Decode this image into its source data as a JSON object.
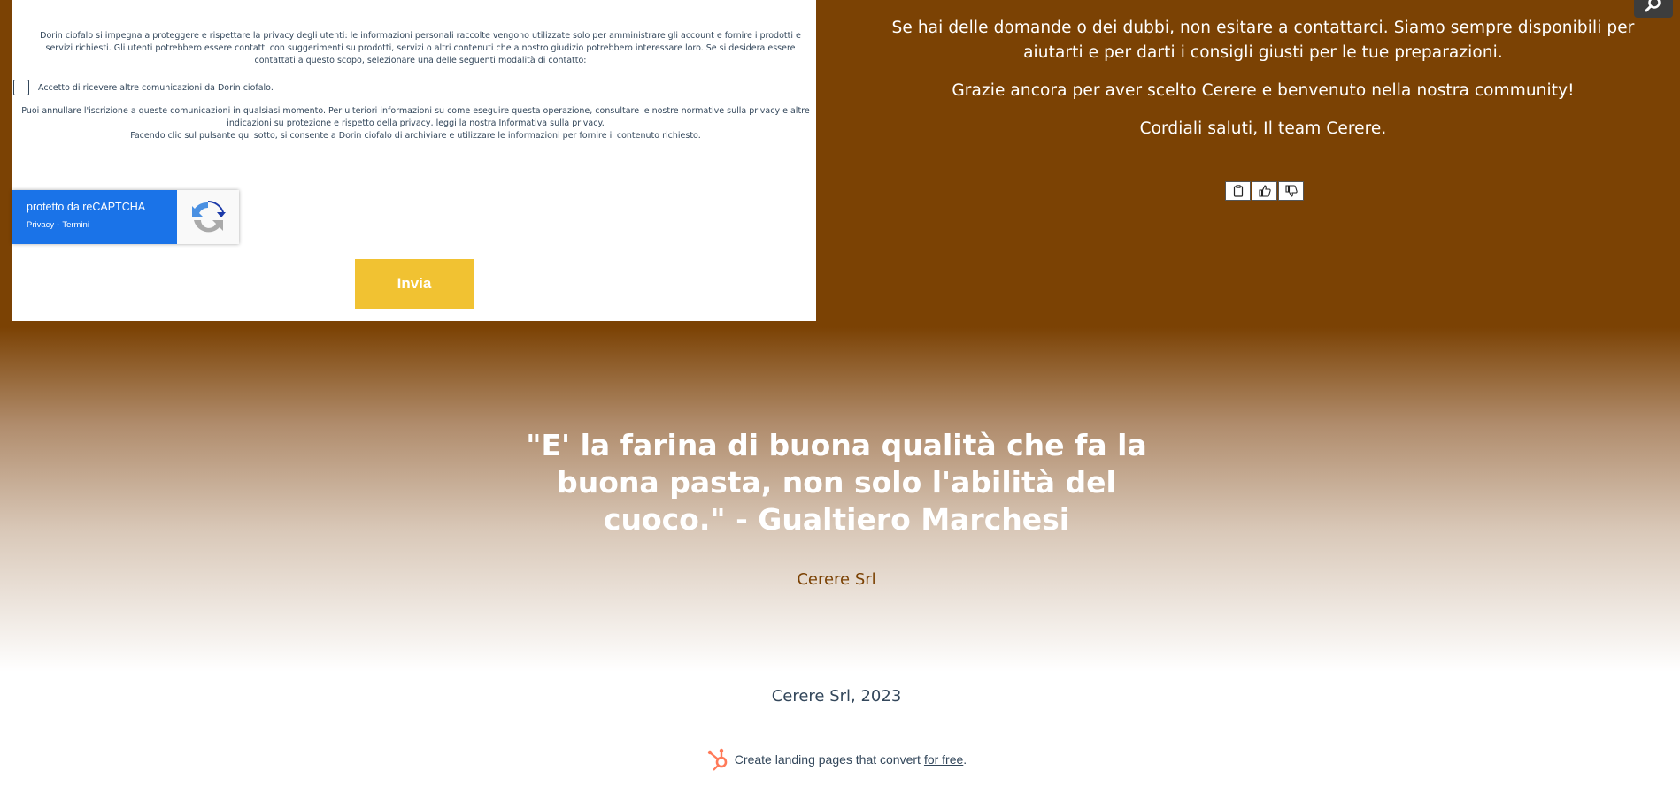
{
  "form": {
    "consent_text": "Dorin ciofalo si impegna a proteggere e rispettare la privacy degli utenti: le informazioni personali raccolte vengono utilizzate solo per amministrare gli account e fornire i prodotti e servizi richiesti. Gli utenti potrebbero essere contatti con suggerimenti su prodotti, servizi o altri contenuti che a nostro giudizio potrebbero interessare loro. Se si desidera essere contattati a questo scopo, selezionare una delle seguenti modalità di contatto:",
    "checkbox_label": "Accetto di ricevere altre comunicazioni da Dorin ciofalo.",
    "unsub_text": "Puoi annullare l'iscrizione a queste comunicazioni in qualsiasi momento. Per ulteriori informazioni su come eseguire questa operazione, consultare le nostre normative sulla privacy e altre indicazioni su protezione e rispetto della privacy, leggi la nostra Informativa sulla privacy.",
    "submit_consent_text": "Facendo clic sul pulsante qui sotto, si consente a Dorin ciofalo di archiviare e utilizzare le informazioni per fornire il contenuto richiesto.",
    "recaptcha": {
      "title": "protetto da reCAPTCHA",
      "privacy": "Privacy",
      "separator": "-",
      "terms": "Termini"
    },
    "submit_label": "Invia"
  },
  "message": {
    "contact_paragraph": "Se hai delle domande o dei dubbi, non esitare a contattarci. Siamo sempre disponibili per aiutarti e per darti i consigli giusti per le tue preparazioni.",
    "thanks_paragraph": "Grazie ancora per aver scelto Cerere e benvenuto nella nostra community!",
    "signoff_paragraph": "Cordiali saluti, Il team Cerere."
  },
  "quote": {
    "text": "\"E' la farina di buona qualità che fa la buona pasta, non solo l'abilità del cuoco.\" - Gualtiero Marchesi",
    "author": "Cerere Srl"
  },
  "footer": {
    "copyright": "Cerere Srl, 2023",
    "hubspot_text": "Create landing pages that convert",
    "hubspot_link": "for free",
    "hubspot_period": "."
  },
  "colors": {
    "brown": "#7b4204",
    "button_yellow": "#f1c232",
    "recaptcha_blue": "#1a73e8",
    "hubspot_orange": "#ff7a59"
  },
  "icons": [
    "clipboard-icon",
    "thumbs-up-icon",
    "thumbs-down-icon",
    "search-icon",
    "recaptcha-logo-icon",
    "hubspot-logo-icon"
  ]
}
